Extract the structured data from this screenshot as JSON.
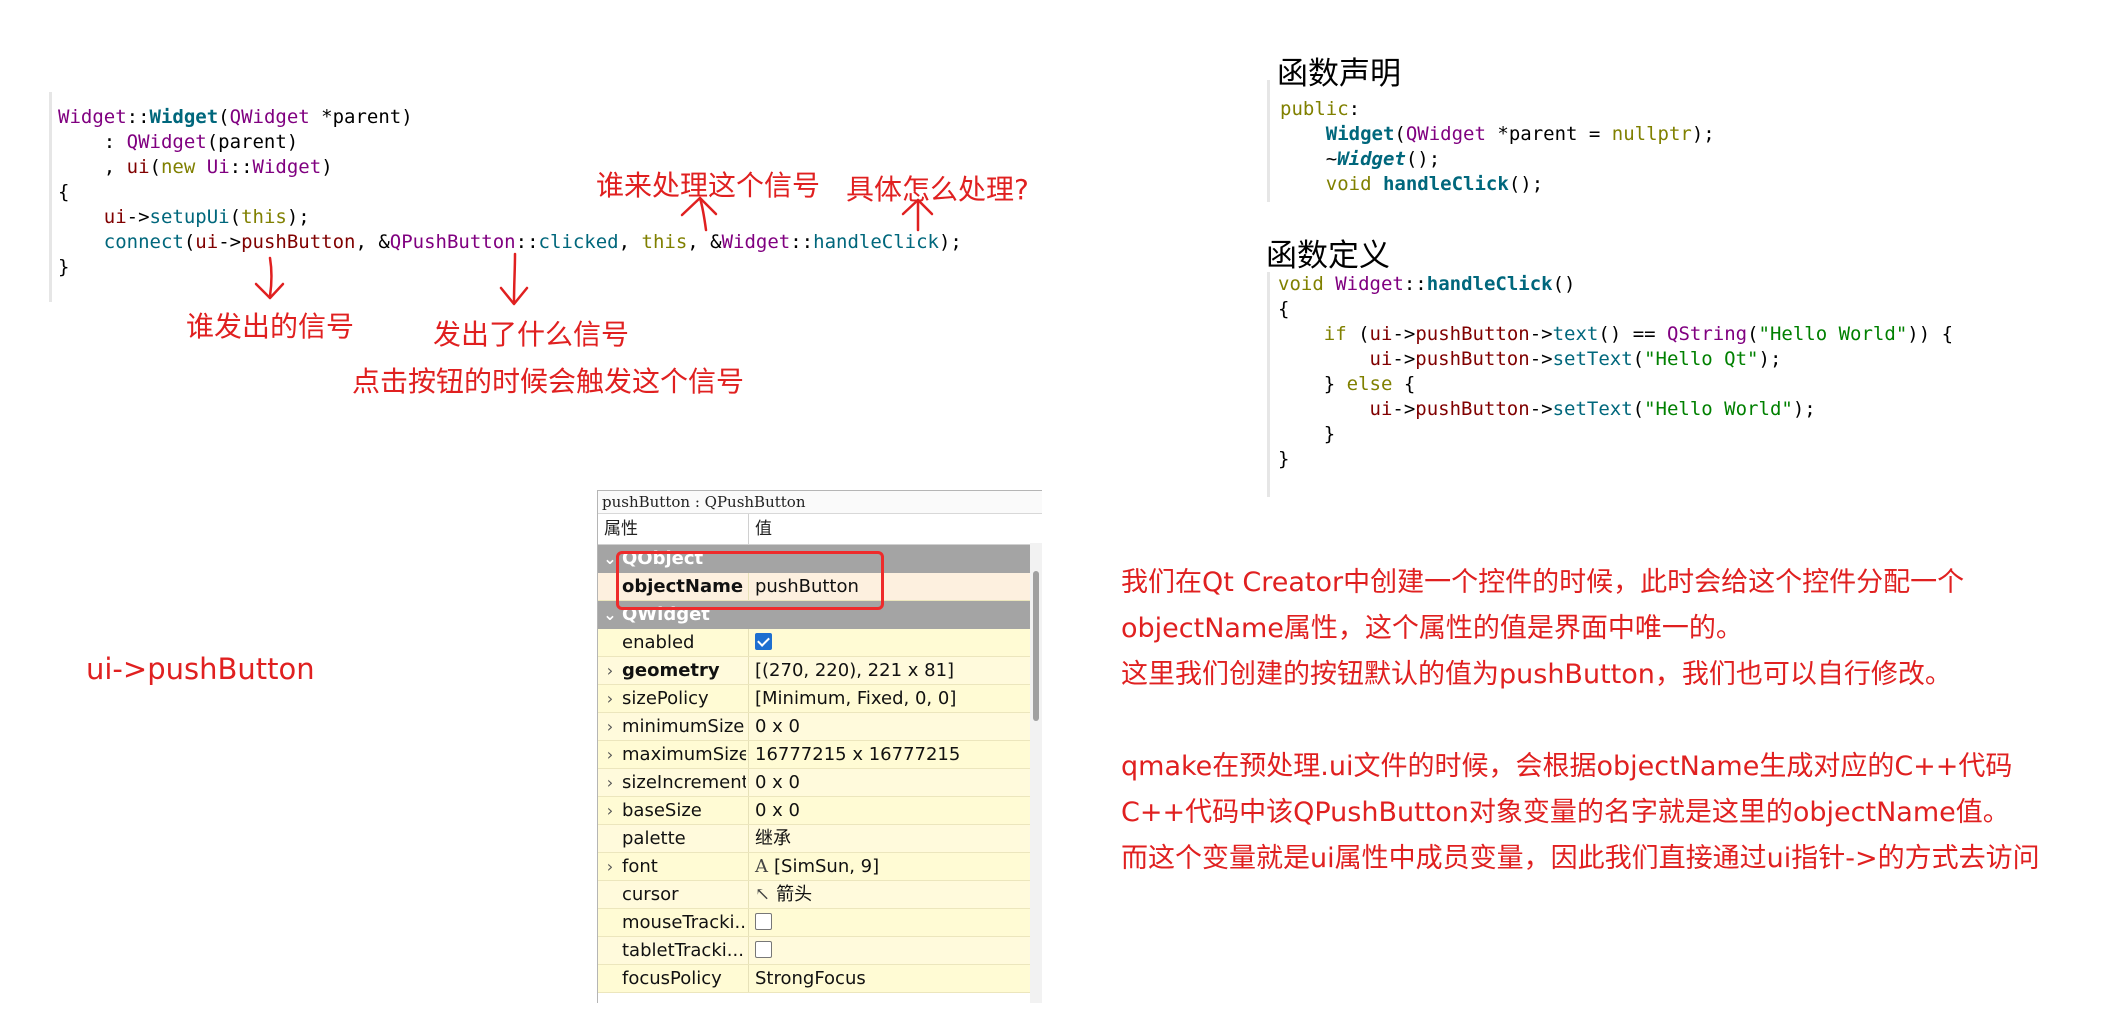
{
  "code_main": {
    "lines": [
      {
        "parts": [
          {
            "t": "Widget",
            "c": "ty"
          },
          {
            "t": "::",
            "c": ""
          },
          {
            "t": "Widget",
            "c": "fnb"
          },
          {
            "t": "(",
            "c": ""
          },
          {
            "t": "QWidget",
            "c": "ty"
          },
          {
            "t": " *parent)",
            "c": ""
          }
        ]
      },
      {
        "parts": [
          {
            "t": "    : ",
            "c": ""
          },
          {
            "t": "QWidget",
            "c": "ty"
          },
          {
            "t": "(parent)",
            "c": ""
          }
        ]
      },
      {
        "parts": [
          {
            "t": "    , ",
            "c": ""
          },
          {
            "t": "ui",
            "c": "mem"
          },
          {
            "t": "(",
            "c": ""
          },
          {
            "t": "new",
            "c": "kw"
          },
          {
            "t": " ",
            "c": ""
          },
          {
            "t": "Ui",
            "c": "ty"
          },
          {
            "t": "::",
            "c": ""
          },
          {
            "t": "Widget",
            "c": "ty"
          },
          {
            "t": ")",
            "c": ""
          }
        ]
      },
      {
        "parts": [
          {
            "t": "{",
            "c": ""
          }
        ]
      },
      {
        "parts": [
          {
            "t": "    ",
            "c": ""
          },
          {
            "t": "ui",
            "c": "mem"
          },
          {
            "t": "->",
            "c": ""
          },
          {
            "t": "setupUi",
            "c": "fn"
          },
          {
            "t": "(",
            "c": ""
          },
          {
            "t": "this",
            "c": "kw"
          },
          {
            "t": ");",
            "c": ""
          }
        ]
      },
      {
        "parts": [
          {
            "t": "    ",
            "c": ""
          },
          {
            "t": "connect",
            "c": "fn"
          },
          {
            "t": "(",
            "c": ""
          },
          {
            "t": "ui",
            "c": "mem"
          },
          {
            "t": "->",
            "c": ""
          },
          {
            "t": "pushButton",
            "c": "mem"
          },
          {
            "t": ", &",
            "c": ""
          },
          {
            "t": "QPushButton",
            "c": "ty"
          },
          {
            "t": "::",
            "c": ""
          },
          {
            "t": "clicked",
            "c": "fn"
          },
          {
            "t": ", ",
            "c": ""
          },
          {
            "t": "this",
            "c": "kw"
          },
          {
            "t": ", &",
            "c": ""
          },
          {
            "t": "Widget",
            "c": "ty"
          },
          {
            "t": "::",
            "c": ""
          },
          {
            "t": "handleClick",
            "c": "fn"
          },
          {
            "t": ");",
            "c": ""
          }
        ]
      },
      {
        "parts": [
          {
            "t": "}",
            "c": ""
          }
        ]
      }
    ]
  },
  "code_decl": {
    "lines": [
      {
        "parts": [
          {
            "t": "public",
            "c": "kw"
          },
          {
            "t": ":",
            "c": ""
          }
        ]
      },
      {
        "parts": [
          {
            "t": "    ",
            "c": ""
          },
          {
            "t": "Widget",
            "c": "fnb"
          },
          {
            "t": "(",
            "c": ""
          },
          {
            "t": "QWidget",
            "c": "ty"
          },
          {
            "t": " *parent = ",
            "c": ""
          },
          {
            "t": "nullptr",
            "c": "kw"
          },
          {
            "t": ");",
            "c": ""
          }
        ]
      },
      {
        "parts": [
          {
            "t": "    ~",
            "c": ""
          },
          {
            "t": "Widget",
            "c": "fnbi"
          },
          {
            "t": "();",
            "c": ""
          }
        ]
      },
      {
        "parts": [
          {
            "t": "    ",
            "c": ""
          },
          {
            "t": "void",
            "c": "kw"
          },
          {
            "t": " ",
            "c": ""
          },
          {
            "t": "handleClick",
            "c": "fnb"
          },
          {
            "t": "();",
            "c": ""
          }
        ]
      }
    ]
  },
  "code_def": {
    "lines": [
      {
        "parts": [
          {
            "t": "void",
            "c": "kw"
          },
          {
            "t": " ",
            "c": ""
          },
          {
            "t": "Widget",
            "c": "ty"
          },
          {
            "t": "::",
            "c": ""
          },
          {
            "t": "handleClick",
            "c": "fnb"
          },
          {
            "t": "()",
            "c": ""
          }
        ]
      },
      {
        "parts": [
          {
            "t": "{",
            "c": ""
          }
        ]
      },
      {
        "parts": [
          {
            "t": "    ",
            "c": ""
          },
          {
            "t": "if",
            "c": "kw"
          },
          {
            "t": " (",
            "c": ""
          },
          {
            "t": "ui",
            "c": "mem"
          },
          {
            "t": "->",
            "c": ""
          },
          {
            "t": "pushButton",
            "c": "mem"
          },
          {
            "t": "->",
            "c": ""
          },
          {
            "t": "text",
            "c": "fn"
          },
          {
            "t": "() == ",
            "c": ""
          },
          {
            "t": "QString",
            "c": "ty"
          },
          {
            "t": "(",
            "c": ""
          },
          {
            "t": "\"Hello World\"",
            "c": "str"
          },
          {
            "t": ")) {",
            "c": ""
          }
        ]
      },
      {
        "parts": [
          {
            "t": "        ",
            "c": ""
          },
          {
            "t": "ui",
            "c": "mem"
          },
          {
            "t": "->",
            "c": ""
          },
          {
            "t": "pushButton",
            "c": "mem"
          },
          {
            "t": "->",
            "c": ""
          },
          {
            "t": "setText",
            "c": "fn"
          },
          {
            "t": "(",
            "c": ""
          },
          {
            "t": "\"Hello Qt\"",
            "c": "str"
          },
          {
            "t": ");",
            "c": ""
          }
        ]
      },
      {
        "parts": [
          {
            "t": "    } ",
            "c": ""
          },
          {
            "t": "else",
            "c": "kw"
          },
          {
            "t": " {",
            "c": ""
          }
        ]
      },
      {
        "parts": [
          {
            "t": "        ",
            "c": ""
          },
          {
            "t": "ui",
            "c": "mem"
          },
          {
            "t": "->",
            "c": ""
          },
          {
            "t": "pushButton",
            "c": "mem"
          },
          {
            "t": "->",
            "c": ""
          },
          {
            "t": "setText",
            "c": "fn"
          },
          {
            "t": "(",
            "c": ""
          },
          {
            "t": "\"Hello World\"",
            "c": "str"
          },
          {
            "t": ");",
            "c": ""
          }
        ]
      },
      {
        "parts": [
          {
            "t": "    }",
            "c": ""
          }
        ]
      },
      {
        "parts": [
          {
            "t": "}",
            "c": ""
          }
        ]
      }
    ]
  },
  "headings": {
    "decl": "函数声明",
    "def": "函数定义"
  },
  "annotations": {
    "who_handles": "谁来处理这个信号",
    "how_handle": "具体怎么处理?",
    "who_emits": "谁发出的信号",
    "what_signal": "发出了什么信号",
    "click_trigger": "点击按钮的时候会触发这个信号",
    "ui_pushbutton": "ui->pushButton"
  },
  "explanation": {
    "lines": [
      "我们在Qt Creator中创建一个控件的时候，此时会给这个控件分配一个",
      "objectName属性，这个属性的值是界面中唯一的。",
      "这里我们创建的按钮默认的值为pushButton，我们也可以自行修改。",
      "",
      "qmake在预处理.ui文件的时候，会根据objectName生成对应的C++代码",
      "C++代码中该QPushButton对象变量的名字就是这里的objectName值。",
      "而这个变量就是ui属性中成员变量，因此我们直接通过ui指针->的方式去访问"
    ]
  },
  "property_editor": {
    "title": "pushButton : QPushButton",
    "col_property": "属性",
    "col_value": "值",
    "rows": [
      {
        "kind": "group",
        "expander": "⌄",
        "name": "QObject",
        "value": ""
      },
      {
        "kind": "sel",
        "expander": "",
        "name": "objectName",
        "value": "pushButton",
        "bold": true
      },
      {
        "kind": "group",
        "expander": "⌄",
        "name": "QWidget",
        "value": ""
      },
      {
        "kind": "normal",
        "expander": "",
        "name": "enabled",
        "value": "",
        "checkbox": "on"
      },
      {
        "kind": "alt",
        "expander": "›",
        "name": "geometry",
        "value": "[(270, 220), 221 x 81]",
        "bold": true
      },
      {
        "kind": "normal",
        "expander": "›",
        "name": "sizePolicy",
        "value": "[Minimum, Fixed, 0, 0]"
      },
      {
        "kind": "alt",
        "expander": "›",
        "name": "minimumSize",
        "value": "0 x 0"
      },
      {
        "kind": "normal",
        "expander": "›",
        "name": "maximumSize",
        "value": "16777215 x 16777215"
      },
      {
        "kind": "alt",
        "expander": "›",
        "name": "sizeIncrement",
        "value": "0 x 0"
      },
      {
        "kind": "normal",
        "expander": "›",
        "name": "baseSize",
        "value": "0 x 0"
      },
      {
        "kind": "alt",
        "expander": "",
        "name": "palette",
        "value": "继承"
      },
      {
        "kind": "normal",
        "expander": "›",
        "name": "font",
        "value": "[SimSun, 9]",
        "prefix": "A"
      },
      {
        "kind": "alt",
        "expander": "",
        "name": "cursor",
        "value": "箭头",
        "prefix": "↖"
      },
      {
        "kind": "normal",
        "expander": "",
        "name": "mouseTracki...",
        "value": "",
        "checkbox": "off"
      },
      {
        "kind": "alt",
        "expander": "",
        "name": "tabletTracki...",
        "value": "",
        "checkbox": "off"
      },
      {
        "kind": "normal",
        "expander": "",
        "name": "focusPolicy",
        "value": "StrongFocus"
      }
    ]
  }
}
